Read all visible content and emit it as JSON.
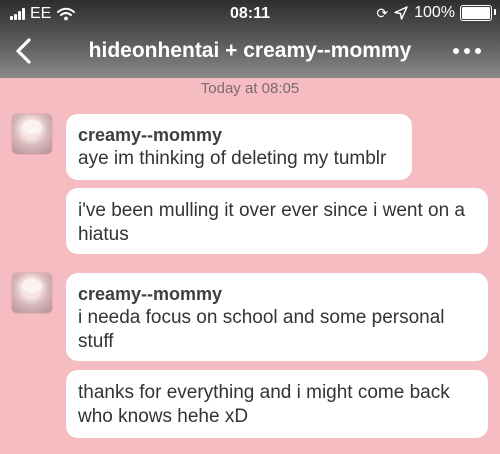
{
  "status_bar": {
    "carrier": "EE",
    "time": "08:11",
    "battery": "100%",
    "battery_level": 1.0
  },
  "nav": {
    "title": "hideonhentai + creamy--mommy"
  },
  "conversation": {
    "timestamp": "Today at 08:05",
    "messages": [
      {
        "sender": "creamy--mommy",
        "text": "aye im thinking of deleting my tumblr"
      },
      {
        "text": "i've been mulling it over ever since i went on a hiatus"
      },
      {
        "sender": "creamy--mommy",
        "text": "i needa focus on school and some personal stuff"
      },
      {
        "text": "thanks for everything and i might come back who knows hehe xD"
      }
    ]
  }
}
